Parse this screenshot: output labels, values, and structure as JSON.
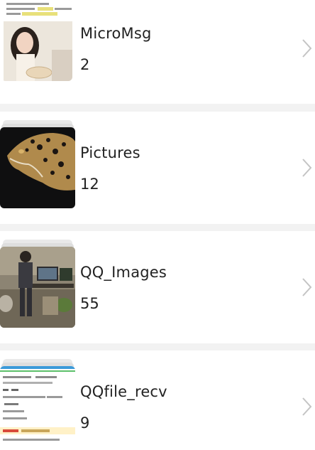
{
  "albums": [
    {
      "name": "MicroMsg",
      "count": "2",
      "thumbnail": "woman-holding-plate-photo",
      "arrow": "chevron-right-icon"
    },
    {
      "name": "Pictures",
      "count": "12",
      "thumbnail": "leopard-photo",
      "arrow": "chevron-right-icon"
    },
    {
      "name": "QQ_Images",
      "count": "55",
      "thumbnail": "man-in-room-photo",
      "arrow": "chevron-right-icon"
    },
    {
      "name": "QQfile_recv",
      "count": "9",
      "thumbnail": "document-screenshot",
      "arrow": "chevron-right-icon"
    }
  ],
  "colors": {
    "background": "#f2f2f2",
    "row": "#ffffff",
    "text": "#222222",
    "chevron": "#c4c4c4"
  }
}
